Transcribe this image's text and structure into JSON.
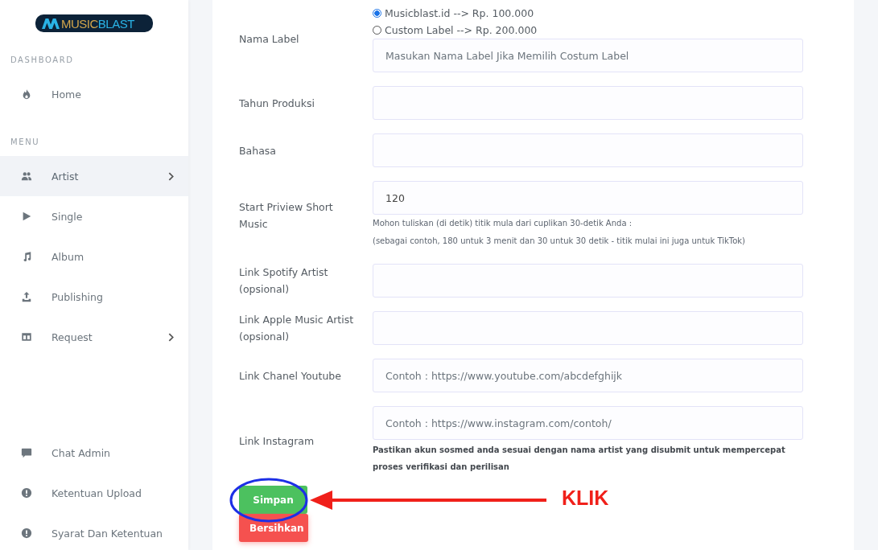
{
  "sidebar": {
    "logo": {
      "part_1": "MUSIC",
      "part_2": "BLAST"
    },
    "sections": [
      {
        "heading": "DASHBOARD",
        "items": [
          {
            "label": "Home",
            "selected": false,
            "expandable": false
          }
        ]
      },
      {
        "heading": "MENU",
        "items": [
          {
            "label": "Artist",
            "selected": true,
            "expandable": true
          },
          {
            "label": "Single",
            "selected": false,
            "expandable": false
          },
          {
            "label": "Album",
            "selected": false,
            "expandable": false
          },
          {
            "label": "Publishing",
            "selected": false,
            "expandable": false
          },
          {
            "label": "Request",
            "selected": false,
            "expandable": true
          }
        ]
      },
      {
        "items": [
          {
            "label": "Chat Admin",
            "selected": false,
            "expandable": false
          },
          {
            "label": "Ketentuan Upload",
            "selected": false,
            "expandable": false
          },
          {
            "label": "Syarat Dan Ketentuan",
            "selected": false,
            "expandable": false
          }
        ]
      }
    ]
  },
  "form": {
    "rows": [
      {
        "kind": "radio",
        "label": "Nama Label",
        "options": [
          {
            "label": "Musicblast.id --> Rp. 100.000",
            "selected": true
          },
          {
            "label": "Custom Label --> Rp. 200.000",
            "selected": false
          }
        ],
        "placeholder": "Masukan Nama Label Jika Memilih Costum Label"
      },
      {
        "kind": "text",
        "label": "Tahun Produksi"
      },
      {
        "kind": "text",
        "label": "Bahasa"
      },
      {
        "kind": "text",
        "label": "Start Priview Short Music",
        "value": "120",
        "hints": [
          "Mohon tuliskan (di detik) titik mula dari cuplikan 30-detik Anda :",
          "(sebagai contoh, 180 untuk 3 menit dan 30 untuk 30 detik - titik mulai ini juga untuk TikTok)"
        ]
      },
      {
        "kind": "text",
        "label": "Link Spotify Artist (opsional)"
      },
      {
        "kind": "text",
        "label": "Link Apple Music Artist (opsional)"
      },
      {
        "kind": "text",
        "label": "Link Chanel Youtube",
        "placeholder": "Contoh : https://www.youtube.com/abcdefghijk"
      },
      {
        "kind": "text",
        "label": "Link Instagram",
        "placeholder": "Contoh : https://www.instagram.com/contoh/",
        "notes": [
          "Pastikan akun sosmed anda sesuai dengan nama artist yang disubmit untuk mempercepat proses verifikasi dan perilisan"
        ]
      }
    ],
    "buttons": [
      {
        "label": "Simpan",
        "kind": "save"
      },
      {
        "label": "Bersihkan",
        "kind": "reset"
      }
    ]
  },
  "annotation": {
    "text": "KLIK"
  }
}
